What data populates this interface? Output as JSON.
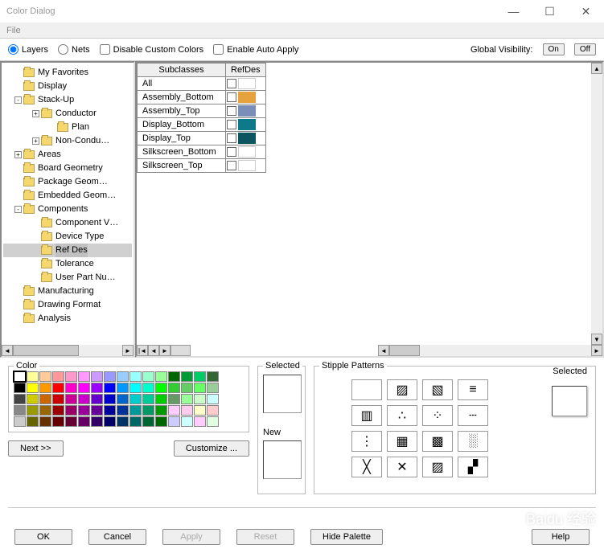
{
  "window": {
    "title": "Color Dialog"
  },
  "menu": {
    "file": "File"
  },
  "toprow": {
    "layers": "Layers",
    "nets": "Nets",
    "disable_custom": "Disable Custom Colors",
    "enable_auto": "Enable Auto Apply",
    "global_vis": "Global Visibility:",
    "on": "On",
    "off": "Off"
  },
  "tree": {
    "items": [
      {
        "label": "My Favorites",
        "indent": 1
      },
      {
        "label": "Display",
        "indent": 1
      },
      {
        "label": "Stack-Up",
        "indent": 1,
        "exp": "-"
      },
      {
        "label": "Conductor",
        "indent": 2,
        "exp": "+"
      },
      {
        "label": "Plan",
        "indent": 3
      },
      {
        "label": "Non-Condu…",
        "indent": 2,
        "exp": "+"
      },
      {
        "label": "Areas",
        "indent": 1,
        "exp": "+"
      },
      {
        "label": "Board Geometry",
        "indent": 1
      },
      {
        "label": "Package Geom…",
        "indent": 1
      },
      {
        "label": "Embedded Geom…",
        "indent": 1
      },
      {
        "label": "Components",
        "indent": 1,
        "exp": "-"
      },
      {
        "label": "Component V…",
        "indent": 2
      },
      {
        "label": "Device Type",
        "indent": 2
      },
      {
        "label": "Ref Des",
        "indent": 2,
        "selected": true
      },
      {
        "label": "Tolerance",
        "indent": 2
      },
      {
        "label": "User Part Nu…",
        "indent": 2
      },
      {
        "label": "Manufacturing",
        "indent": 1
      },
      {
        "label": "Drawing Format",
        "indent": 1
      },
      {
        "label": "Analysis",
        "indent": 1
      }
    ]
  },
  "table": {
    "head_sub": "Subclasses",
    "head_ref": "RefDes",
    "rows": [
      {
        "name": "All",
        "color": ""
      },
      {
        "name": "Assembly_Bottom",
        "color": "#e6a23c"
      },
      {
        "name": "Assembly_Top",
        "color": "#7a8fb8"
      },
      {
        "name": "Display_Bottom",
        "color": "#0d7a8a"
      },
      {
        "name": "Display_Top",
        "color": "#0a5560"
      },
      {
        "name": "Silkscreen_Bottom",
        "color": ""
      },
      {
        "name": "Silkscreen_Top",
        "color": ""
      }
    ]
  },
  "color_section": {
    "legend": "Color",
    "next": "Next >>",
    "customize": "Customize ...",
    "palette": [
      "#ffffff",
      "#ffff99",
      "#ffcc99",
      "#ff9999",
      "#ff99cc",
      "#ff99ff",
      "#cc99ff",
      "#9999ff",
      "#99ccff",
      "#99ffff",
      "#99ffcc",
      "#99ff99",
      "#006600",
      "#009933",
      "#00cc66",
      "#336633",
      "#000000",
      "#ffff00",
      "#ff9900",
      "#ff0000",
      "#ff00cc",
      "#ff00ff",
      "#9900ff",
      "#0000ff",
      "#0099ff",
      "#00ffff",
      "#00ffcc",
      "#00ff00",
      "#33cc33",
      "#66cc66",
      "#66ff66",
      "#99cc99",
      "#444444",
      "#cccc00",
      "#cc6600",
      "#cc0000",
      "#cc0099",
      "#cc00cc",
      "#6600cc",
      "#0000cc",
      "#0066cc",
      "#00cccc",
      "#00cc99",
      "#00cc00",
      "#669966",
      "#99ff99",
      "#ccffcc",
      "#ccffff",
      "#888888",
      "#999900",
      "#996600",
      "#990000",
      "#990066",
      "#990099",
      "#660099",
      "#000099",
      "#003399",
      "#009999",
      "#009966",
      "#009900",
      "#ffccff",
      "#ffccee",
      "#ffffcc",
      "#ffcccc",
      "#cccccc",
      "#666600",
      "#663300",
      "#660000",
      "#660033",
      "#660066",
      "#330066",
      "#000066",
      "#003366",
      "#006666",
      "#006633",
      "#006600",
      "#ccccff",
      "#ccffff",
      "#ffccff",
      "#e0ffe0"
    ]
  },
  "selected_section": {
    "legend": "Selected",
    "new": "New"
  },
  "stipple_section": {
    "legend": "Stipple Patterns",
    "selected": "Selected"
  },
  "buttons": {
    "ok": "OK",
    "cancel": "Cancel",
    "apply": "Apply",
    "reset": "Reset",
    "hide": "Hide Palette",
    "help": "Help"
  }
}
